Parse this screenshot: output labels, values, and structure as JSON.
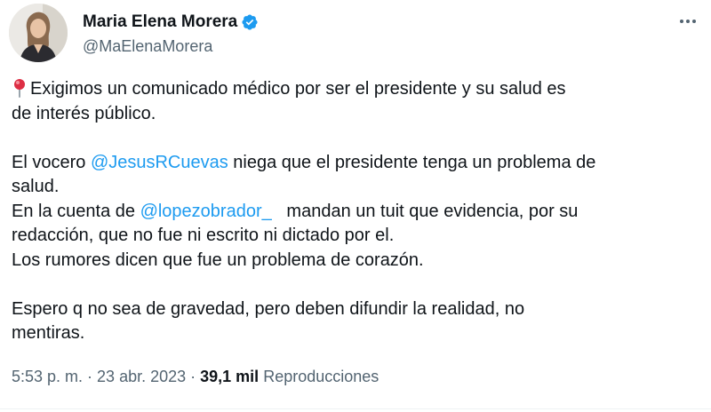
{
  "author": {
    "name": "Maria Elena Morera",
    "handle": "@MaElenaMorera"
  },
  "icons": {
    "verified": "verified-badge-icon",
    "more": "more-options-icon",
    "pin": "round-pushpin-emoji"
  },
  "colors": {
    "mention": "#1d9bf0",
    "secondary_text": "#536471",
    "primary_text": "#0f1419",
    "verified": "#1d9bf0"
  },
  "tweet": {
    "line1": "Exigimos un comunicado médico por ser el presidente y su salud es",
    "line2": "de interés público.",
    "p2_pre": "El vocero ",
    "mention1": "@JesusRCuevas",
    "p2_post": " niega que el presidente tenga un problema de",
    "p2_line2": "salud.",
    "p3_pre": "En la cuenta de ",
    "mention2": "@lopezobrador_",
    "p3_post": "   mandan un tuit que evidencia, por su",
    "p3_line2": "redacción, que no fue ni escrito ni dictado por el.",
    "p4": "Los rumores dicen que fue un problema de corazón.",
    "p5_line1": "Espero q no sea de gravedad, pero deben difundir la realidad, no",
    "p5_line2": "mentiras."
  },
  "meta": {
    "time": "5:53 p. m.",
    "sep1": " · ",
    "date": "23 abr. 2023",
    "sep2": " · ",
    "views_count": "39,1 mil",
    "views_label": " Reproducciones"
  }
}
